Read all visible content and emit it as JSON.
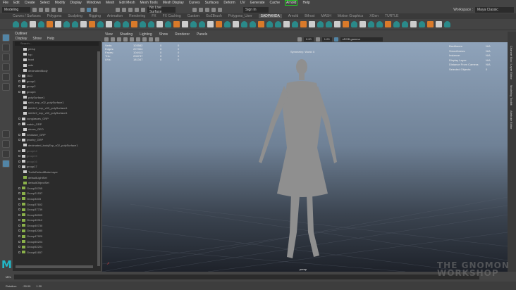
{
  "menubar": [
    "File",
    "Edit",
    "Create",
    "Select",
    "Modify",
    "Display",
    "Windows",
    "Mesh",
    "Edit Mesh",
    "Mesh Tools",
    "Mesh Display",
    "Curves",
    "Surfaces",
    "Deform",
    "UV",
    "Generate",
    "Cache",
    "Arnold",
    "Help"
  ],
  "status": {
    "mode": "Modeling",
    "live_surface": "No Live Surface",
    "sign_in": "Sign In",
    "workspace_label": "Workspace :",
    "workspace": "Maya Classic"
  },
  "shelf_tabs": [
    "Curves / Surfaces",
    "Polygons",
    "Sculpting",
    "Rigging",
    "Animation",
    "Rendering",
    "FX",
    "FX Caching",
    "Custom",
    "GoZBrush",
    "Polygons_User",
    "SADPANDA",
    "Arnold",
    "Bifrost",
    "MASH",
    "Motion Graphics",
    "XGen",
    "TURTLE"
  ],
  "shelf_active": "SADPANDA",
  "outliner": {
    "title": "Outliner",
    "menu": [
      "Display",
      "Show",
      "Help"
    ],
    "search_placeholder": "Search...",
    "items": [
      "persp",
      "top",
      "front",
      "side",
      "decimatedBody",
      "OLD",
      "group1",
      "group2",
      "group3",
      "polySurface1",
      "shirt_exp_v02_polySurface1",
      "shirtU2_exp_v03_polySurface1",
      "shirtU2_exp_v03_polySurface1",
      "sunglasses_GRP",
      "watch_GRP",
      "shoes_GEO",
      "necklace_GRP",
      "jewelry_GRP",
      "decimated_bodyExp_v02_polySurface1",
      "group14",
      "group15",
      "group16",
      "group17",
      "TurtleDefaultBakeLayer",
      "defaultLightSet",
      "defaultObjectSet",
      "Group20765",
      "Group21537",
      "Group3403",
      "Group37602",
      "Group37739",
      "Group38909",
      "Group40312",
      "Group40730",
      "Group42080",
      "Group47920",
      "Group50204",
      "Group52201",
      "Group61657"
    ]
  },
  "viewport": {
    "menu": [
      "View",
      "Shading",
      "Lighting",
      "Show",
      "Renderer",
      "Panels"
    ],
    "field1": "0.00",
    "field2": "1.00",
    "colorspace": "sRGB gamma",
    "stats": [
      [
        "Verts:",
        "103582",
        "0",
        "0"
      ],
      [
        "Edges:",
        "207304",
        "0",
        "0"
      ],
      [
        "Faces:",
        "104413",
        "0",
        "0"
      ],
      [
        "Tris:",
        "206737",
        "0",
        "0"
      ],
      [
        "UVs:",
        "181347",
        "0",
        "0"
      ]
    ],
    "symmetry": "Symmetry: World X",
    "hud_right": [
      [
        "Backfaces:",
        "N/A"
      ],
      [
        "Smoothness:",
        "N/A"
      ],
      [
        "Instance:",
        "N/A"
      ],
      [
        "Display Layer:",
        "N/A"
      ],
      [
        "Distance From Camera:",
        "N/A"
      ],
      [
        "Selected Objects:",
        "0"
      ]
    ],
    "camera": "persp"
  },
  "right_tabs": [
    "Channel Box / Layer Editor",
    "Modeling Toolkit",
    "Attribute Editor"
  ],
  "cmd": {
    "label": "MEL"
  },
  "help": {
    "label": "Rotation:",
    "v1": "-30.00",
    "v2": "1.20"
  },
  "watermark": "THE GNOMON WORKSHOP"
}
